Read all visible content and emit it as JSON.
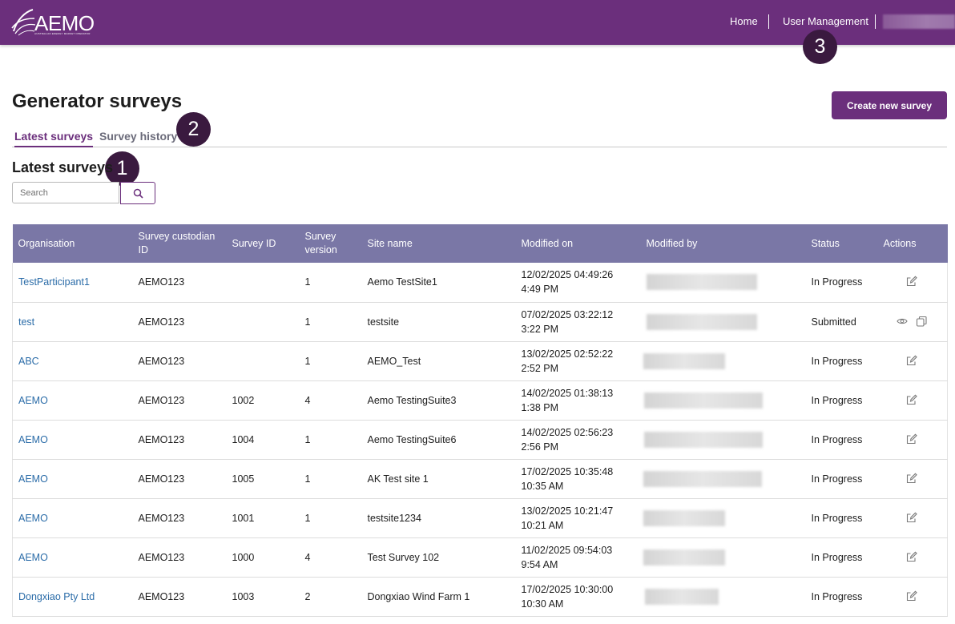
{
  "header": {
    "logo_text": "AEMO",
    "logo_subtext": "AUSTRALIAN ENERGY MARKET OPERATOR",
    "nav": [
      {
        "label": "Home"
      },
      {
        "label": "User Management"
      }
    ]
  },
  "callouts": [
    "1",
    "2",
    "3"
  ],
  "page": {
    "title": "Generator surveys",
    "create_button": "Create new survey",
    "tabs": [
      {
        "label": "Latest surveys",
        "active": true
      },
      {
        "label": "Survey history",
        "active": false
      }
    ],
    "section_title": "Latest surveys",
    "search": {
      "placeholder": "Search",
      "value": ""
    }
  },
  "table": {
    "columns": [
      "Organisation",
      "Survey custodian ID",
      "Survey ID",
      "Survey version",
      "Site name",
      "Modified on",
      "Modified by",
      "Status",
      "Actions"
    ],
    "rows": [
      {
        "organisation": "TestParticipant1",
        "custodian_id": "AEMO123",
        "survey_id": "",
        "version": "1",
        "site_name": "Aemo TestSite1",
        "modified_on": "12/02/2025 04:49:26 4:49 PM",
        "status": "In Progress",
        "actions": [
          "edit-icon"
        ]
      },
      {
        "organisation": "test",
        "custodian_id": "AEMO123",
        "survey_id": "",
        "version": "1",
        "site_name": "testsite",
        "modified_on": "07/02/2025 03:22:12 3:22 PM",
        "status": "Submitted",
        "actions": [
          "eye-icon",
          "copy-icon"
        ]
      },
      {
        "organisation": "ABC",
        "custodian_id": "AEMO123",
        "survey_id": "",
        "version": "1",
        "site_name": "AEMO_Test",
        "modified_on": "13/02/2025 02:52:22 2:52 PM",
        "status": "In Progress",
        "actions": [
          "edit-icon"
        ]
      },
      {
        "organisation": "AEMO",
        "custodian_id": "AEMO123",
        "survey_id": "1002",
        "version": "4",
        "site_name": "Aemo TestingSuite3",
        "modified_on": "14/02/2025 01:38:13 1:38 PM",
        "status": "In Progress",
        "actions": [
          "edit-icon"
        ]
      },
      {
        "organisation": "AEMO",
        "custodian_id": "AEMO123",
        "survey_id": "1004",
        "version": "1",
        "site_name": "Aemo TestingSuite6",
        "modified_on": "14/02/2025 02:56:23 2:56 PM",
        "status": "In Progress",
        "actions": [
          "edit-icon"
        ]
      },
      {
        "organisation": "AEMO",
        "custodian_id": "AEMO123",
        "survey_id": "1005",
        "version": "1",
        "site_name": "AK Test site 1",
        "modified_on": "17/02/2025 10:35:48 10:35 AM",
        "status": "In Progress",
        "actions": [
          "edit-icon"
        ]
      },
      {
        "organisation": "AEMO",
        "custodian_id": "AEMO123",
        "survey_id": "1001",
        "version": "1",
        "site_name": "testsite1234",
        "modified_on": "13/02/2025 10:21:47 10:21 AM",
        "status": "In Progress",
        "actions": [
          "edit-icon"
        ]
      },
      {
        "organisation": "AEMO",
        "custodian_id": "AEMO123",
        "survey_id": "1000",
        "version": "4",
        "site_name": "Test Survey 102",
        "modified_on": "11/02/2025 09:54:03 9:54 AM",
        "status": "In Progress",
        "actions": [
          "edit-icon"
        ]
      },
      {
        "organisation": "Dongxiao Pty Ltd",
        "custodian_id": "AEMO123",
        "survey_id": "1003",
        "version": "2",
        "site_name": "Dongxiao Wind Farm 1",
        "modified_on": "17/02/2025 10:30:00 10:30 AM",
        "status": "In Progress",
        "actions": [
          "edit-icon"
        ]
      }
    ]
  },
  "colors": {
    "brand_purple": "#6b2f7c",
    "table_header": "#7a77a6",
    "link_blue": "#2b6ca8",
    "callout": "#3a1a3f"
  }
}
